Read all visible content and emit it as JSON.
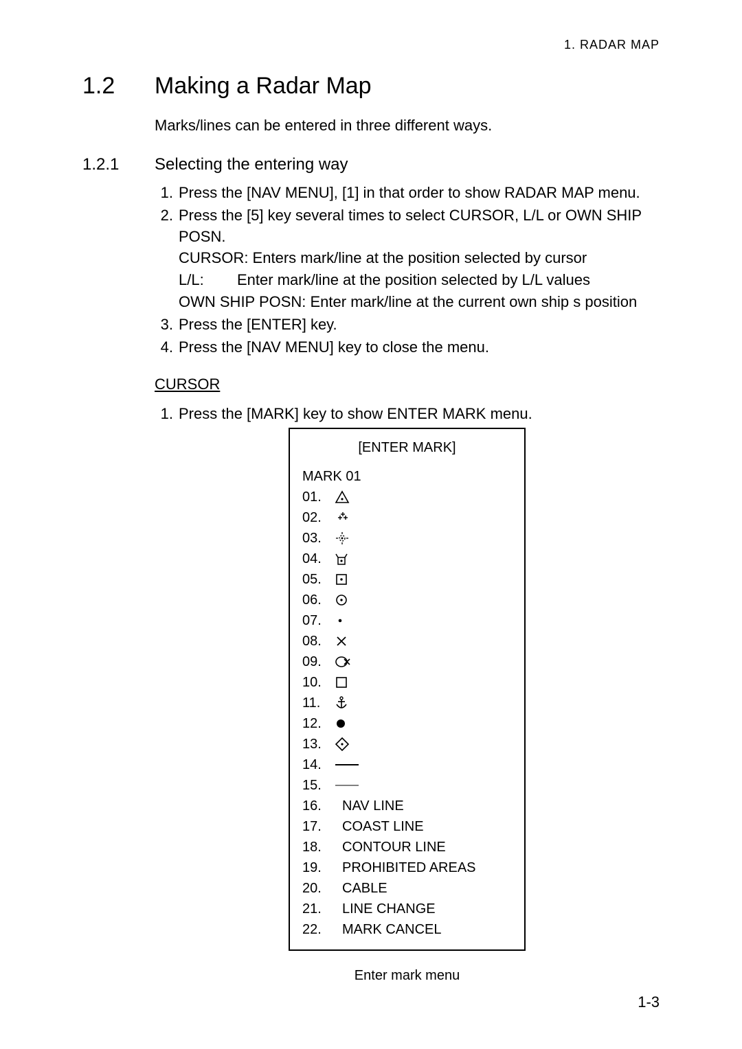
{
  "header": "1. RADAR MAP",
  "section": {
    "number": "1.2",
    "title": "Making a Radar Map"
  },
  "intro": "Marks/lines can be entered in three different ways.",
  "subsection": {
    "number": "1.2.1",
    "title": "Selecting the entering way"
  },
  "steps_a": [
    {
      "n": "1.",
      "text": "Press the [NAV MENU], [1] in that order to show RADAR MAP menu."
    },
    {
      "n": "2.",
      "text": "Press the [5] key several times to select CURSOR, L/L or OWN SHIP POSN."
    }
  ],
  "defs": {
    "cursor": "CURSOR: Enters mark/line at the position selected by cursor",
    "ll_key": "L/L:",
    "ll_val": "Enter mark/line at the position selected by L/L values",
    "own": "OWN SHIP POSN: Enter mark/line at the current own ship s position"
  },
  "steps_b": [
    {
      "n": "3.",
      "text": "Press the [ENTER] key."
    },
    {
      "n": "4.",
      "text": "Press the [NAV MENU] key to close the menu."
    }
  ],
  "cursor_heading": "CURSOR",
  "cursor_step": {
    "n": "1.",
    "text": "Press the [MARK] key to show ENTER MARK menu."
  },
  "menu": {
    "title": "[ENTER MARK]",
    "subtitle": "MARK 01",
    "items": [
      {
        "idx": "01.",
        "icon": "triangle-dot",
        "label": ""
      },
      {
        "idx": "02.",
        "icon": "plus-cluster",
        "label": ""
      },
      {
        "idx": "03.",
        "icon": "sun-dot",
        "label": ""
      },
      {
        "idx": "04.",
        "icon": "beacon",
        "label": ""
      },
      {
        "idx": "05.",
        "icon": "square-dot",
        "label": ""
      },
      {
        "idx": "06.",
        "icon": "circle-dot",
        "label": ""
      },
      {
        "idx": "07.",
        "icon": "dot",
        "label": ""
      },
      {
        "idx": "08.",
        "icon": "x-mark",
        "label": ""
      },
      {
        "idx": "09.",
        "icon": "circle-x",
        "label": ""
      },
      {
        "idx": "10.",
        "icon": "square",
        "label": ""
      },
      {
        "idx": "11.",
        "icon": "anchor",
        "label": ""
      },
      {
        "idx": "12.",
        "icon": "filled-circle",
        "label": ""
      },
      {
        "idx": "13.",
        "icon": "diamond-dot",
        "label": ""
      },
      {
        "idx": "14.",
        "icon": "solid-line",
        "label": ""
      },
      {
        "idx": "15.",
        "icon": "thin-line",
        "label": ""
      },
      {
        "idx": "16.",
        "icon": "",
        "label": "NAV LINE"
      },
      {
        "idx": "17.",
        "icon": "",
        "label": "COAST LINE"
      },
      {
        "idx": "18.",
        "icon": "",
        "label": "CONTOUR LINE"
      },
      {
        "idx": "19.",
        "icon": "",
        "label": "PROHIBITED AREAS"
      },
      {
        "idx": "20.",
        "icon": "",
        "label": "CABLE"
      },
      {
        "idx": "21.",
        "icon": "",
        "label": "LINE CHANGE"
      },
      {
        "idx": "22.",
        "icon": "",
        "label": "MARK CANCEL"
      }
    ]
  },
  "caption": "Enter mark menu",
  "page_number": "1-3"
}
